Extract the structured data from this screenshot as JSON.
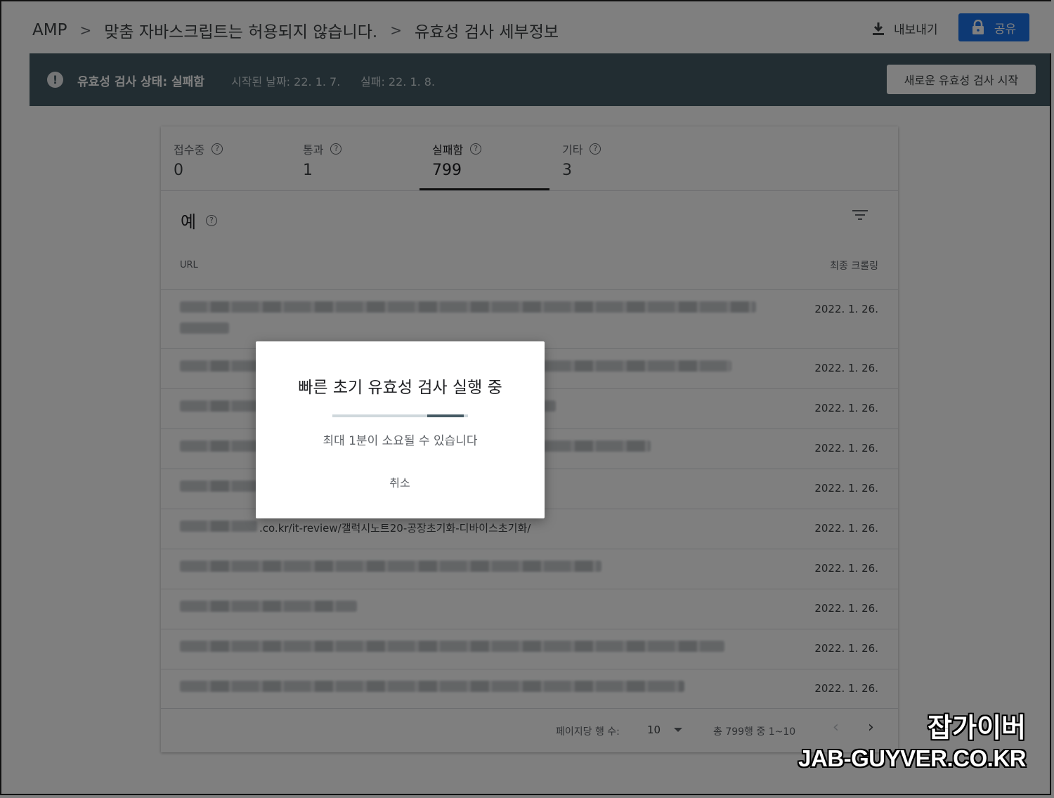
{
  "breadcrumb": {
    "items": [
      "AMP",
      "맞춤 자바스크립트는 허용되지 않습니다.",
      "유효성 검사 세부정보"
    ],
    "separator": ">"
  },
  "header": {
    "export_label": "내보내기",
    "share_label": "공유",
    "accent_color": "#1a73e8"
  },
  "status": {
    "label": "유효성 검사 상태: 실패함",
    "started": "시작된 날짜: 22. 1. 7.",
    "failed": "실패: 22. 1. 8.",
    "new_validation_label": "새로운 유효성 검사 시작",
    "bar_color": "#455a64"
  },
  "tabs": [
    {
      "label": "접수중",
      "value": "0"
    },
    {
      "label": "통과",
      "value": "1"
    },
    {
      "label": "실패함",
      "value": "799"
    },
    {
      "label": "기타",
      "value": "3"
    }
  ],
  "examples": {
    "title": "예",
    "columns": {
      "url": "URL",
      "crawled": "최종 크롤링"
    },
    "rows": [
      {
        "url": "",
        "date": "2022. 1. 26."
      },
      {
        "url": "",
        "date": "2022. 1. 26."
      },
      {
        "url": "",
        "date": "2022. 1. 26."
      },
      {
        "url": "",
        "date": "2022. 1. 26."
      },
      {
        "url": "",
        "date": "2022. 1. 26."
      },
      {
        "url": ".co.kr/it-review/갤럭시노트20-공장초기화-디바이스초기화/",
        "date": "2022. 1. 26."
      },
      {
        "url": "",
        "date": "2022. 1. 26."
      },
      {
        "url": "",
        "date": "2022. 1. 26."
      },
      {
        "url": "",
        "date": "2022. 1. 26."
      },
      {
        "url": "",
        "date": "2022. 1. 26."
      }
    ]
  },
  "pagination": {
    "rows_per_page_label": "페이지당 행 수:",
    "rows_per_page_value": "10",
    "range_text": "총 799행 중 1~10",
    "prev": "‹",
    "next": "›"
  },
  "dialog": {
    "title": "빠른 초기 유효성 검사 실행 중",
    "message": "최대 1분이 소요될 수 있습니다",
    "cancel_label": "취소"
  },
  "watermark": {
    "ko": "잡가이버",
    "en": "JAB-GUYVER.CO.KR"
  }
}
